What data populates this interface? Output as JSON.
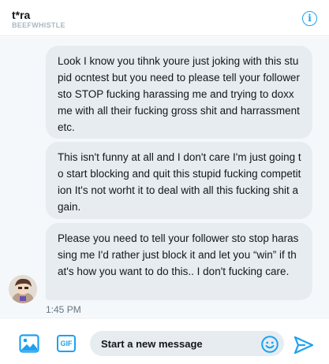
{
  "header": {
    "name": "t*ra",
    "handle": "BEEFWHISTLE",
    "info_icon": "info-circle-icon",
    "info_glyph": "i"
  },
  "messages": [
    {
      "text": "Look I know you tihnk youre just joking with this stupid ocntest but you need to please tell your follower sto STOP fucking harassing me and trying to doxx me with all their fucking gross shit and harrassment etc."
    },
    {
      "text": "This isn't funny at all and I don't care I'm just going to start blocking and quit this stupid fucking competition It's not worht it to deal with all this fucking shit again."
    },
    {
      "text": "Please you need to tell your follower sto stop harassing me I'd rather just block it and let you “win” if that's how you want to do this.. I don't fucking care."
    }
  ],
  "timestamp": "1:45 PM",
  "composer": {
    "placeholder": "Start a new message",
    "media_icon": "image-icon",
    "gif_label": "GIF",
    "emoji_icon": "emoji-icon",
    "send_icon": "send-icon"
  },
  "colors": {
    "accent": "#1da1f2",
    "bubble": "#e6ecf0",
    "background": "#f5f8fa",
    "muted": "#657786"
  }
}
